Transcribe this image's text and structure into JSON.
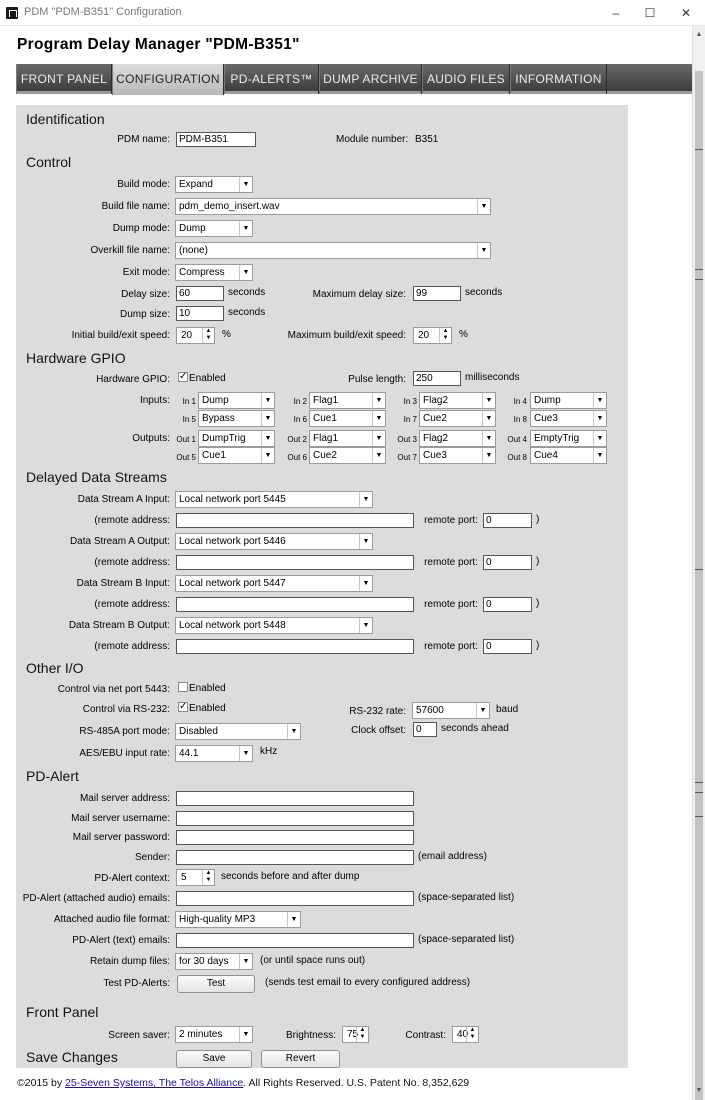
{
  "window": {
    "title": "PDM \"PDM-B351\" Configuration",
    "minimize": "–",
    "maximize": "☐",
    "close": "✕"
  },
  "header": {
    "title": "Program Delay Manager \"PDM-B351\""
  },
  "tabs": [
    "FRONT PANEL",
    "CONFIGURATION",
    "PD-ALERTS™",
    "DUMP ARCHIVE",
    "AUDIO FILES",
    "INFORMATION"
  ],
  "identification": {
    "heading": "Identification",
    "pdm_name_label": "PDM name:",
    "pdm_name": "PDM-B351",
    "module_number_label": "Module number:",
    "module_number": "B351"
  },
  "control": {
    "heading": "Control",
    "build_mode_label": "Build mode:",
    "build_mode": "Expand",
    "build_file_label": "Build file name:",
    "build_file": "pdm_demo_insert.wav",
    "dump_mode_label": "Dump mode:",
    "dump_mode": "Dump",
    "overkill_label": "Overkill file name:",
    "overkill": "(none)",
    "exit_mode_label": "Exit mode:",
    "exit_mode": "Compress",
    "delay_size_label": "Delay size:",
    "delay_size": "60",
    "seconds": "seconds",
    "max_delay_label": "Maximum delay size:",
    "max_delay": "99",
    "dump_size_label": "Dump size:",
    "dump_size": "10",
    "initial_speed_label": "Initial build/exit speed:",
    "initial_speed": "20",
    "percent": "%",
    "max_speed_label": "Maximum build/exit speed:",
    "max_speed": "20"
  },
  "gpio": {
    "heading": "Hardware GPIO",
    "hw_label": "Hardware GPIO:",
    "enabled_label": "Enabled",
    "pulse_label": "Pulse length:",
    "pulse": "250",
    "ms": "milliseconds",
    "inputs_label": "Inputs:",
    "outputs_label": "Outputs:",
    "inputs": [
      {
        "tag": "In 1",
        "value": "Dump"
      },
      {
        "tag": "In 2",
        "value": "Flag1"
      },
      {
        "tag": "In 3",
        "value": "Flag2"
      },
      {
        "tag": "In 4",
        "value": "Dump"
      },
      {
        "tag": "In 5",
        "value": "Bypass"
      },
      {
        "tag": "In 6",
        "value": "Cue1"
      },
      {
        "tag": "In 7",
        "value": "Cue2"
      },
      {
        "tag": "In 8",
        "value": "Cue3"
      }
    ],
    "outputs": [
      {
        "tag": "Out 1",
        "value": "DumpTrig"
      },
      {
        "tag": "Out 2",
        "value": "Flag1"
      },
      {
        "tag": "Out 3",
        "value": "Flag2"
      },
      {
        "tag": "Out 4",
        "value": "EmptyTrig"
      },
      {
        "tag": "Out 5",
        "value": "Cue1"
      },
      {
        "tag": "Out 6",
        "value": "Cue2"
      },
      {
        "tag": "Out 7",
        "value": "Cue3"
      },
      {
        "tag": "Out 8",
        "value": "Cue4"
      }
    ]
  },
  "streams": {
    "heading": "Delayed Data Streams",
    "remote_address_label": "(remote address:",
    "remote_port_label": "remote port:",
    "close_paren": ")",
    "items": [
      {
        "label": "Data Stream A Input:",
        "value": "Local network port 5445",
        "port": "0"
      },
      {
        "label": "Data Stream A Output:",
        "value": "Local network port 5446",
        "port": "0"
      },
      {
        "label": "Data Stream B Input:",
        "value": "Local network port 5447",
        "port": "0"
      },
      {
        "label": "Data Stream B Output:",
        "value": "Local network port 5448",
        "port": "0"
      }
    ]
  },
  "other_io": {
    "heading": "Other I/O",
    "net_port_label": "Control via net port 5443:",
    "net_enabled": "Enabled",
    "rs232_label": "Control via RS-232:",
    "rs232_enabled": "Enabled",
    "rs232_rate_label": "RS-232 rate:",
    "rs232_rate": "57600",
    "baud": "baud",
    "rs485_label": "RS-485A port mode:",
    "rs485": "Disabled",
    "clock_offset_label": "Clock offset:",
    "clock_offset": "0",
    "seconds_ahead": "seconds ahead",
    "aes_label": "AES/EBU input rate:",
    "aes": "44.1",
    "khz": "kHz"
  },
  "pd_alert": {
    "heading": "PD-Alert",
    "mail_server_label": "Mail server address:",
    "mail_user_label": "Mail server username:",
    "mail_pass_label": "Mail server password:",
    "sender_label": "Sender:",
    "email_hint": "(email address)",
    "context_label": "PD-Alert context:",
    "context": "5",
    "context_hint": "seconds before and after dump",
    "attached_emails_label": "PD-Alert (attached audio) emails:",
    "list_hint": "(space-separated list)",
    "format_label": "Attached audio file format:",
    "format": "High-quality MP3",
    "text_emails_label": "PD-Alert (text) emails:",
    "retain_label": "Retain dump files:",
    "retain": "for 30 days",
    "retain_hint": "(or until space runs out)",
    "test_label": "Test PD-Alerts:",
    "test_button": "Test",
    "test_hint": "(sends test email to every configured address)"
  },
  "front_panel": {
    "heading": "Front Panel",
    "saver_label": "Screen saver:",
    "saver": "2 minutes",
    "brightness_label": "Brightness:",
    "brightness": "75",
    "contrast_label": "Contrast:",
    "contrast": "40"
  },
  "save": {
    "heading": "Save Changes",
    "save_button": "Save",
    "revert_button": "Revert"
  },
  "footer": {
    "prefix": "©2015 by ",
    "link": "25-Seven Systems, The Telos Alliance",
    "suffix": ".  All Rights Reserved.  U.S. Patent No. 8,352,629"
  }
}
